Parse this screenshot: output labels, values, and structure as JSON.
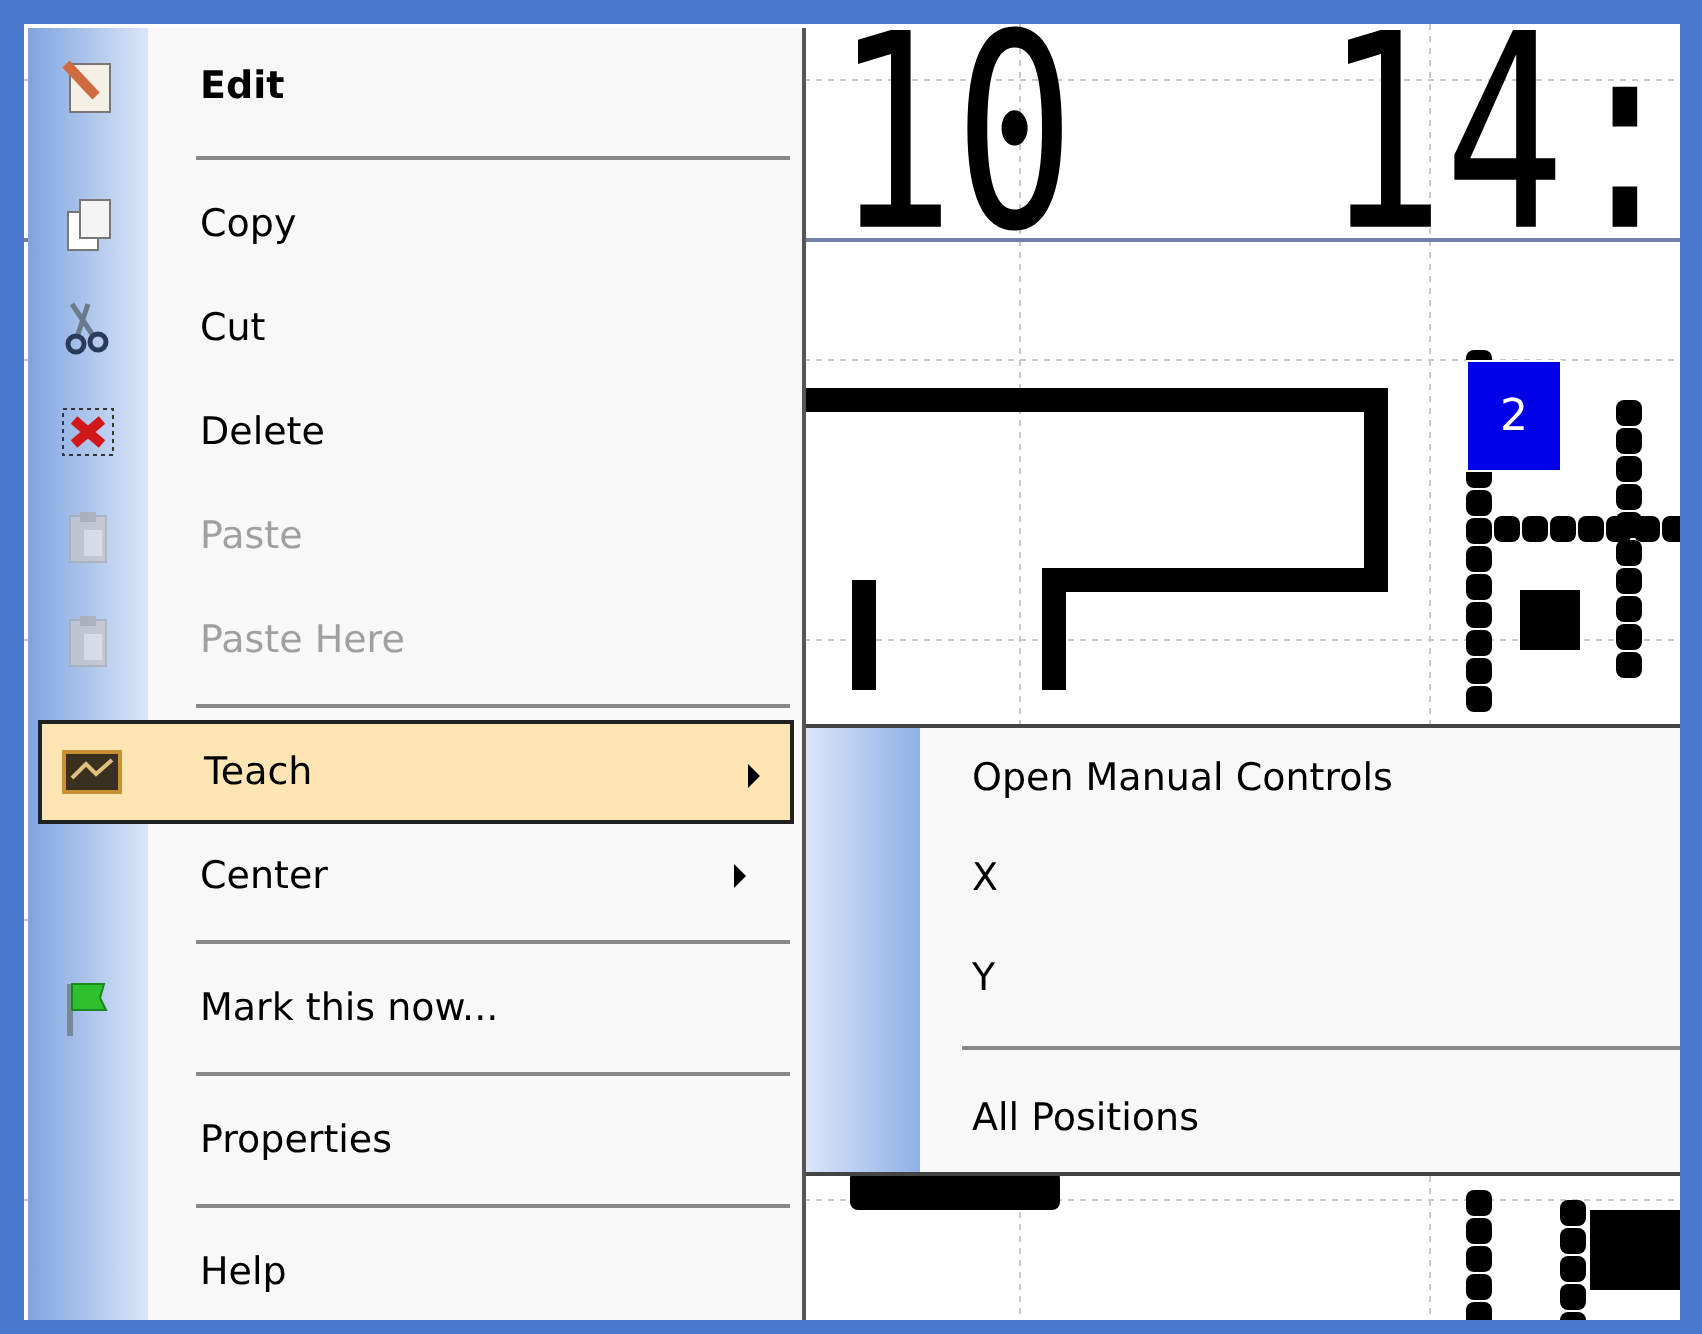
{
  "canvas": {
    "texts": [
      "10",
      "14:"
    ],
    "badge": "2"
  },
  "menu": {
    "items": [
      {
        "kind": "header",
        "label": "Edit"
      },
      {
        "kind": "separator"
      },
      {
        "kind": "item",
        "label": "Copy",
        "disabled": false,
        "selected": false,
        "submenu": false
      },
      {
        "kind": "item",
        "label": "Cut",
        "disabled": false,
        "selected": false,
        "submenu": false
      },
      {
        "kind": "item",
        "label": "Delete",
        "disabled": false,
        "selected": false,
        "submenu": false
      },
      {
        "kind": "item",
        "label": "Paste",
        "disabled": true,
        "selected": false,
        "submenu": false
      },
      {
        "kind": "item",
        "label": "Paste Here",
        "disabled": true,
        "selected": false,
        "submenu": false
      },
      {
        "kind": "separator"
      },
      {
        "kind": "item",
        "label": "Teach",
        "disabled": false,
        "selected": true,
        "submenu": true
      },
      {
        "kind": "item",
        "label": "Center",
        "disabled": false,
        "selected": false,
        "submenu": true
      },
      {
        "kind": "separator"
      },
      {
        "kind": "item",
        "label": "Mark this now...",
        "disabled": false,
        "selected": false,
        "submenu": false
      },
      {
        "kind": "separator"
      },
      {
        "kind": "item",
        "label": "Properties",
        "disabled": false,
        "selected": false,
        "submenu": false
      },
      {
        "kind": "separator"
      },
      {
        "kind": "item",
        "label": "Help",
        "disabled": false,
        "selected": false,
        "submenu": false
      }
    ]
  },
  "submenu": {
    "items": [
      {
        "kind": "item",
        "label": "Open Manual Controls"
      },
      {
        "kind": "item",
        "label": "X"
      },
      {
        "kind": "item",
        "label": "Y"
      },
      {
        "kind": "separator"
      },
      {
        "kind": "item",
        "label": "All Positions"
      }
    ]
  }
}
